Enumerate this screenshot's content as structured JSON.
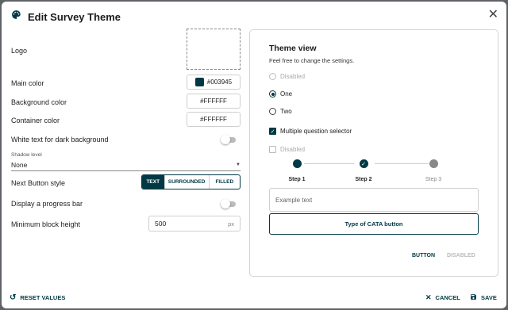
{
  "dialog": {
    "title": "Edit Survey Theme",
    "close_icon": "close-icon",
    "palette_icon": "palette-icon"
  },
  "settings": {
    "logo_label": "Logo",
    "main_color_label": "Main color",
    "main_color_value": "#003945",
    "background_color_label": "Background color",
    "background_color_value": "#FFFFFF",
    "container_color_label": "Container color",
    "container_color_value": "#FFFFFF",
    "white_text_label": "White text for dark background",
    "white_text_enabled": false,
    "shadow_level_label": "Shadow level",
    "shadow_level_value": "None",
    "next_button_style_label": "Next Button style",
    "next_button_styles": [
      "TEXT",
      "SURROUNDED",
      "FILLED"
    ],
    "next_button_style_selected": "TEXT",
    "progress_bar_label": "Display a progress bar",
    "progress_bar_enabled": false,
    "min_block_height_label": "Minimum block height",
    "min_block_height_value": "500",
    "min_block_height_unit": "px"
  },
  "theme_view": {
    "title": "Theme view",
    "subtitle": "Feel free to change the settings.",
    "radio_disabled_label": "Disabled",
    "radio_one_label": "One",
    "radio_two_label": "Two",
    "radio_selected": "One",
    "checkbox_multi_label": "Multiple question selector",
    "checkbox_multi_checked": true,
    "checkbox_disabled_label": "Disabled",
    "steps": [
      {
        "label": "Step 1",
        "state": "active"
      },
      {
        "label": "Step 2",
        "state": "done"
      },
      {
        "label": "Step 3",
        "state": "future"
      }
    ],
    "example_placeholder": "Example text",
    "cata_button_label": "Type of CATA button",
    "button_label": "BUTTON",
    "disabled_button_label": "DISABLED"
  },
  "footer": {
    "reset_label": "RESET VALUES",
    "cancel_label": "CANCEL",
    "save_label": "SAVE"
  },
  "colors": {
    "primary": "#003945",
    "disabled": "#aaaaaa"
  }
}
